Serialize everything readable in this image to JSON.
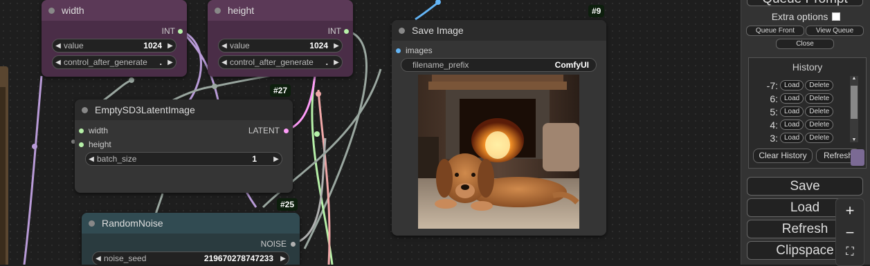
{
  "nodes": {
    "width": {
      "title": "width",
      "out_type": "INT",
      "value_label": "value",
      "value": "1024",
      "control_label": "control_after_generate",
      "control_value": "."
    },
    "height": {
      "title": "height",
      "out_type": "INT",
      "value_label": "value",
      "value": "1024",
      "control_label": "control_after_generate",
      "control_value": "."
    },
    "empty_latent": {
      "id": "#27",
      "title": "EmptySD3LatentImage",
      "in_width": "width",
      "in_height": "height",
      "out_type": "LATENT",
      "batch_label": "batch_size",
      "batch_value": "1"
    },
    "random_noise": {
      "id": "#25",
      "title": "RandomNoise",
      "out_type": "NOISE",
      "seed_label": "noise_seed",
      "seed_value": "219670278747233"
    },
    "save_image": {
      "id": "#9",
      "title": "Save Image",
      "in_images": "images",
      "prefix_label": "filename_prefix",
      "prefix_value": "ComfyUI"
    }
  },
  "panel": {
    "queue_prompt": "Queue Prompt",
    "extra_options": "Extra options",
    "queue_front": "Queue Front",
    "view_queue": "View Queue",
    "close": "Close",
    "history_title": "History",
    "history": [
      {
        "num": "-7:",
        "load": "Load",
        "delete": "Delete"
      },
      {
        "num": "6:",
        "load": "Load",
        "delete": "Delete"
      },
      {
        "num": "5:",
        "load": "Load",
        "delete": "Delete"
      },
      {
        "num": "4:",
        "load": "Load",
        "delete": "Delete"
      },
      {
        "num": "3:",
        "load": "Load",
        "delete": "Delete"
      }
    ],
    "clear_history": "Clear History",
    "refresh_small": "Refresh",
    "save": "Save",
    "load": "Load",
    "refresh": "Refresh",
    "clipspace": "Clipspace"
  },
  "colors": {
    "int_wire": "#b99bd8",
    "latent": "#ff9cf9",
    "noise": "#b0b0b0",
    "image": "#64b5f6",
    "badge_bg": "#0d1f0d"
  },
  "icons": {
    "zoom_in": "+",
    "zoom_out": "−",
    "fit": "⛶",
    "prev": "◀",
    "next": "▶"
  }
}
